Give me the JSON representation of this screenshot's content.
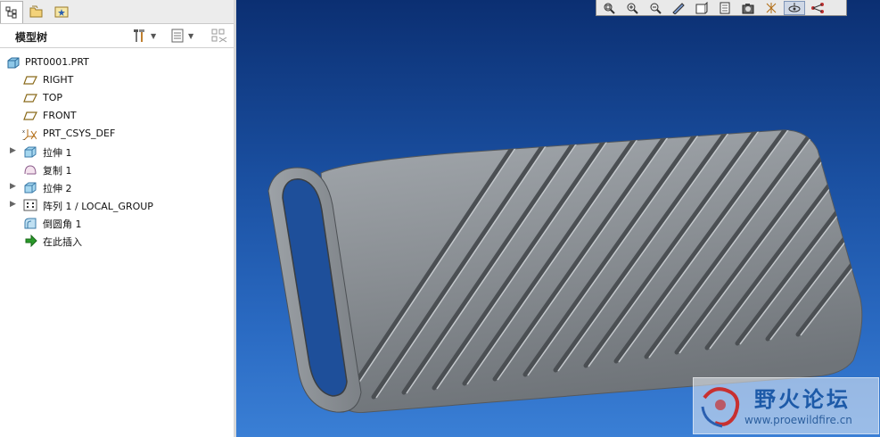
{
  "left_panel": {
    "tabs": [
      {
        "name": "model-tree-tab",
        "icon": "model-tree-icon",
        "selected": true
      },
      {
        "name": "folder-browser-tab",
        "icon": "folder-icon",
        "selected": false
      },
      {
        "name": "favorites-tab",
        "icon": "favorites-icon",
        "selected": false
      }
    ],
    "tree_title": "模型树",
    "header_buttons": [
      {
        "icon": "settings-tools-icon"
      },
      {
        "icon": "show-columns-icon"
      },
      {
        "icon": "filter-icon"
      }
    ]
  },
  "tree": {
    "root": {
      "label": "PRT0001.PRT",
      "icon": "part-icon"
    },
    "items": [
      {
        "label": "RIGHT",
        "icon": "datum-plane-icon",
        "expandable": false
      },
      {
        "label": "TOP",
        "icon": "datum-plane-icon",
        "expandable": false
      },
      {
        "label": "FRONT",
        "icon": "datum-plane-icon",
        "expandable": false
      },
      {
        "label": "PRT_CSYS_DEF",
        "icon": "coordinate-system-icon",
        "expandable": false
      },
      {
        "label": "拉伸 1",
        "icon": "extrude-icon",
        "expandable": true
      },
      {
        "label": "复制 1",
        "icon": "copy-surface-icon",
        "expandable": false
      },
      {
        "label": "拉伸 2",
        "icon": "extrude-icon",
        "expandable": true
      },
      {
        "label": "阵列 1 / LOCAL_GROUP",
        "icon": "pattern-icon",
        "expandable": true
      },
      {
        "label": "倒圆角 1",
        "icon": "round-icon",
        "expandable": false
      },
      {
        "label": "在此插入",
        "icon": "insert-here-arrow-icon",
        "expandable": false
      }
    ]
  },
  "view_toolbar": {
    "buttons": [
      {
        "icon": "refit-icon"
      },
      {
        "icon": "zoom-in-icon"
      },
      {
        "icon": "zoom-out-icon"
      },
      {
        "icon": "repaint-icon"
      },
      {
        "icon": "display-style-icon"
      },
      {
        "icon": "saved-views-icon"
      },
      {
        "icon": "view-manager-icon"
      },
      {
        "icon": "datum-display-icon"
      },
      {
        "icon": "spin-center-icon",
        "active": true
      },
      {
        "icon": "annotation-display-icon"
      }
    ]
  },
  "watermark": {
    "title": "野火论坛",
    "url": "www.proewildfire.cn"
  },
  "colors": {
    "viewport_top": "#0b2f72",
    "viewport_bottom": "#3a7fd5",
    "model_gray": "#8a8f94",
    "watermark_blue": "#1d5aa8"
  }
}
